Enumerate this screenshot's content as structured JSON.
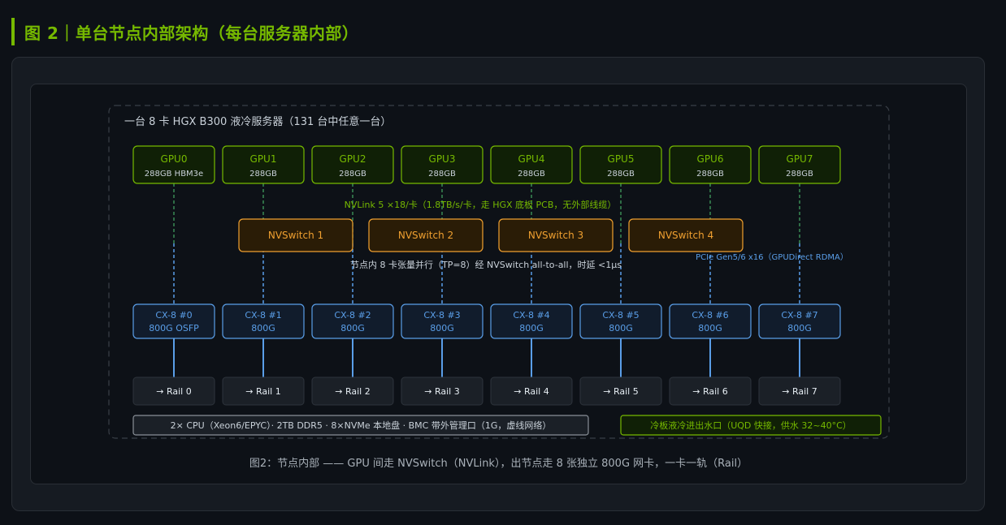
{
  "header": {
    "title": "图 2｜单台节点内部架构（每台服务器内部）"
  },
  "node_label": "一台 8 卡 HGX B300 液冷服务器（131 台中任意一台）",
  "gpus": [
    {
      "name": "GPU0",
      "mem": "288GB HBM3e"
    },
    {
      "name": "GPU1",
      "mem": "288GB"
    },
    {
      "name": "GPU2",
      "mem": "288GB"
    },
    {
      "name": "GPU3",
      "mem": "288GB"
    },
    {
      "name": "GPU4",
      "mem": "288GB"
    },
    {
      "name": "GPU5",
      "mem": "288GB"
    },
    {
      "name": "GPU6",
      "mem": "288GB"
    },
    {
      "name": "GPU7",
      "mem": "288GB"
    }
  ],
  "nvlink_note": "NVLink 5 ×18/卡（1.8TB/s/卡，走 HGX 底板 PCB，无外部线缆）",
  "nvswitches": [
    "NVSwitch 1",
    "NVSwitch 2",
    "NVSwitch 3",
    "NVSwitch 4"
  ],
  "tp_note": "节点内 8 卡张量并行（TP=8）经 NVSwitch all-to-all，时延 <1μs",
  "pcie_note": "PCIe Gen5/6 x16（GPUDirect RDMA）",
  "nics": [
    {
      "name": "CX-8 #0",
      "speed": "800G OSFP"
    },
    {
      "name": "CX-8 #1",
      "speed": "800G"
    },
    {
      "name": "CX-8 #2",
      "speed": "800G"
    },
    {
      "name": "CX-8 #3",
      "speed": "800G"
    },
    {
      "name": "CX-8 #4",
      "speed": "800G"
    },
    {
      "name": "CX-8 #5",
      "speed": "800G"
    },
    {
      "name": "CX-8 #6",
      "speed": "800G"
    },
    {
      "name": "CX-8 #7",
      "speed": "800G"
    }
  ],
  "rails": [
    "→ Rail 0",
    "→ Rail 1",
    "→ Rail 2",
    "→ Rail 3",
    "→ Rail 4",
    "→ Rail 5",
    "→ Rail 6",
    "→ Rail 7"
  ],
  "host_note": "2× CPU（Xeon6/EPYC）· 2TB DDR5 · 8×NVMe 本地盘 · BMC 带外管理口（1G，虚线网络）",
  "cooling_note": "冷板液冷进出水口（UQD 快接，供水 32~40°C）",
  "caption": "图2：节点内部 —— GPU 间走 NVSwitch（NVLink），出节点走 8 张独立 800G 网卡，一卡一轨（Rail）",
  "colors": {
    "accent_green": "#76b900",
    "gpu_fill": "#102006",
    "nvswitch_orange": "#f0a030",
    "nvswitch_fill": "#2a1c06",
    "nic_blue": "#5a9ee8",
    "nic_fill": "#111c2c",
    "rail_fill": "#1b2027"
  }
}
